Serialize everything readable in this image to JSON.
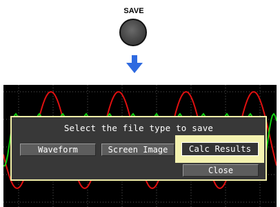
{
  "save_key": {
    "label": "SAVE"
  },
  "dialog": {
    "title": "Select the file type to save",
    "options": {
      "waveform": "Waveform",
      "screen_image": "Screen Image",
      "calc_results": "Calc Results"
    },
    "close_label": "Close",
    "selected": "Calc Results"
  },
  "colors": {
    "highlight": "#f4f2b0",
    "dialog_bg": "#383838",
    "dialog_border": "#f2f0a8",
    "arrow": "#2f6ae0",
    "wave_red": "#e01010",
    "wave_green": "#10d010",
    "grid": "#5a5a5a"
  }
}
